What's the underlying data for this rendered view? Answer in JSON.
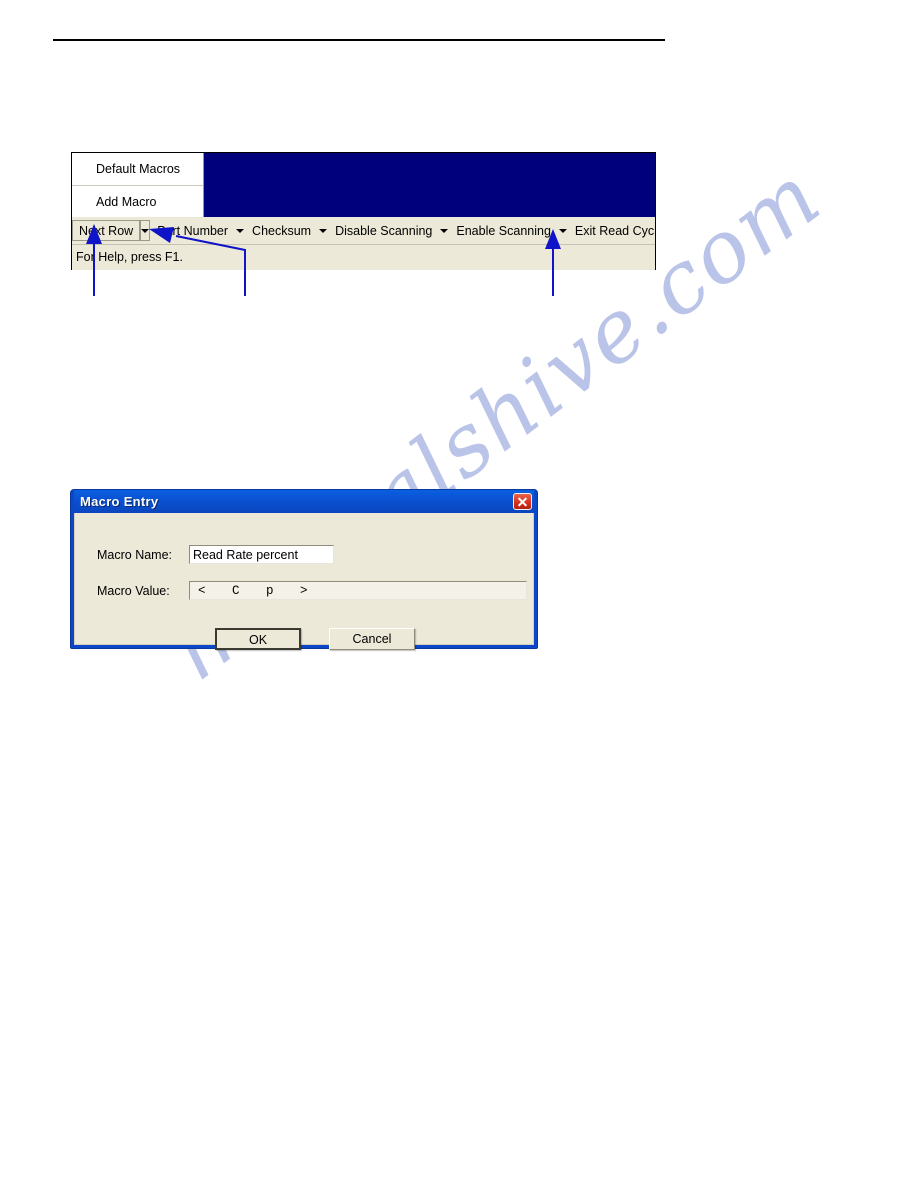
{
  "page": {
    "rule": "horizontal-rule",
    "watermark": "manualshive.com",
    "watermark_color": "#b9c4e8"
  },
  "app_window": {
    "client_color": "#00007d",
    "menu": {
      "items": [
        {
          "label": "Default Macros"
        },
        {
          "label": "Add Macro"
        }
      ]
    },
    "toolbar": {
      "buttons": [
        {
          "label": "Next Row",
          "has_arrow": true
        },
        {
          "label": "Part Number",
          "has_arrow": true
        },
        {
          "label": "Checksum",
          "has_arrow": true
        },
        {
          "label": "Disable Scanning",
          "has_arrow": true
        },
        {
          "label": "Enable Scanning",
          "has_arrow": true
        },
        {
          "label": "Exit Read Cycle",
          "has_arrow": false
        }
      ]
    },
    "status_bar": {
      "text": "For Help, press F1."
    }
  },
  "dialog": {
    "title": "Macro Entry",
    "close_icon": "close-icon",
    "accent_color": "#0a48c8",
    "fields": [
      {
        "label": "Macro Name:",
        "value": "Read Rate percent"
      },
      {
        "label": "Macro Value:",
        "value": "<   C   p   >"
      }
    ],
    "buttons": [
      {
        "label": "OK",
        "default": true
      },
      {
        "label": "Cancel",
        "default": false
      }
    ]
  },
  "annotations": {
    "color": "#0f14c8",
    "leaders": [
      {
        "name": "leader-next-row"
      },
      {
        "name": "leader-dropdown-arrow"
      },
      {
        "name": "leader-enable-scanning-arrow"
      }
    ]
  }
}
